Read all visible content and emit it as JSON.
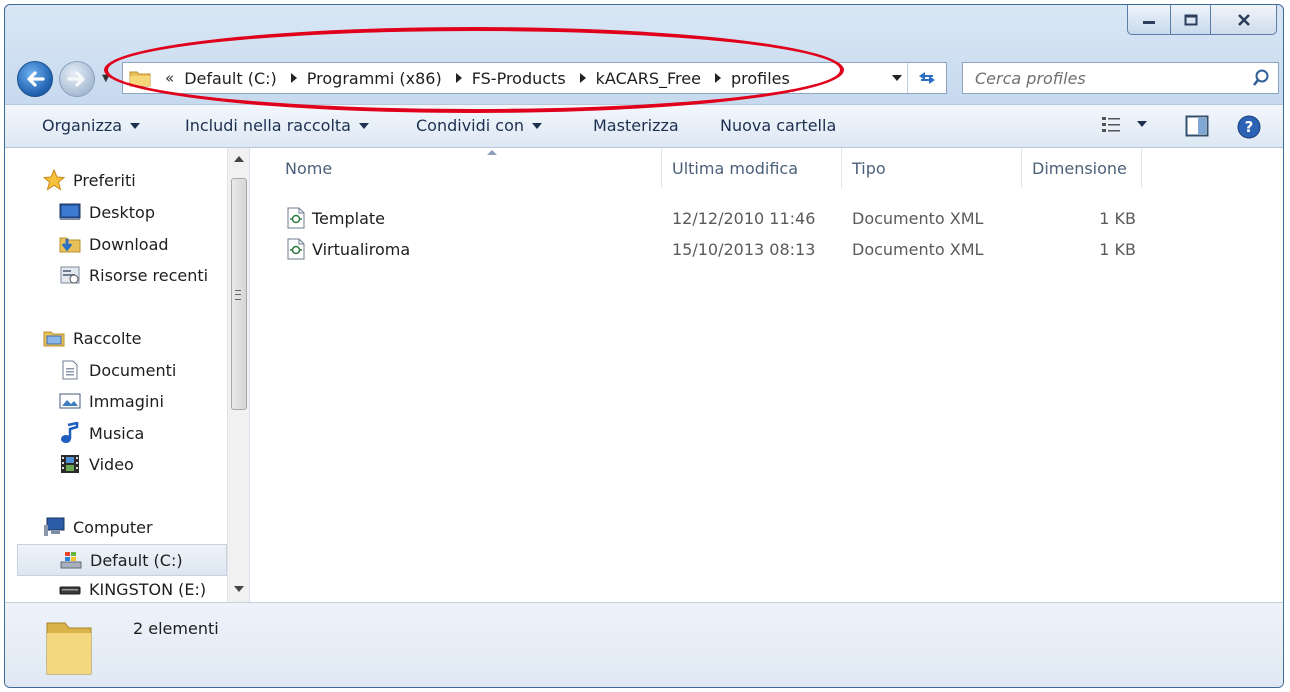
{
  "window": {
    "controls": {
      "minimize_icon": "minimize-icon",
      "maximize_icon": "maximize-icon",
      "close_icon": "close-icon"
    }
  },
  "address_bar": {
    "overflow": "«",
    "breadcrumbs": [
      "Default (C:)",
      "Programmi (x86)",
      "FS-Products",
      "kACARS_Free",
      "profiles"
    ]
  },
  "search": {
    "placeholder": "Cerca profiles"
  },
  "toolbar": {
    "organize": "Organizza",
    "include_in_library": "Includi nella raccolta",
    "share_with": "Condividi con",
    "burn": "Masterizza",
    "new_folder": "Nuova cartella"
  },
  "nav": {
    "favorites": {
      "label": "Preferiti",
      "items": [
        "Desktop",
        "Download",
        "Risorse recenti"
      ]
    },
    "libraries": {
      "label": "Raccolte",
      "items": [
        "Documenti",
        "Immagini",
        "Musica",
        "Video"
      ]
    },
    "computer": {
      "label": "Computer",
      "items": [
        "Default (C:)",
        "KINGSTON (E:)"
      ]
    }
  },
  "columns": {
    "name": "Nome",
    "modified": "Ultima modifica",
    "type": "Tipo",
    "size": "Dimensione"
  },
  "files": [
    {
      "name": "Template",
      "modified": "12/12/2010 11:46",
      "type": "Documento XML",
      "size": "1 KB"
    },
    {
      "name": "Virtualiroma",
      "modified": "15/10/2013 08:13",
      "type": "Documento XML",
      "size": "1 KB"
    }
  ],
  "status": {
    "count_text": "2 elementi"
  },
  "colors": {
    "annotation": "#e0001b",
    "window_frame": "#c6d9ee",
    "accent": "#1e5fae"
  }
}
